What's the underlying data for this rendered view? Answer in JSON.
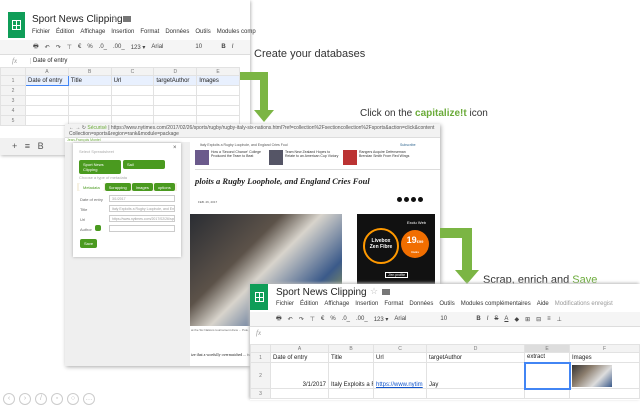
{
  "top_sheet": {
    "title": "Sport News Clipping",
    "menu": [
      "Fichier",
      "Édition",
      "Affichage",
      "Insertion",
      "Format",
      "Données",
      "Outils",
      "Modules comp"
    ],
    "toolbar": {
      "currency": "€",
      "percent": "%",
      "dec_less": ".0_",
      "dec_more": ".00_",
      "format": "123 ▾",
      "font": "Arial",
      "size": "10",
      "bold": "B",
      "italic": "I"
    },
    "formula_label": "fx",
    "formula": "Date of entry",
    "columns": [
      "A",
      "B",
      "C",
      "D",
      "E"
    ],
    "rows": [
      "1",
      "2",
      "3",
      "4",
      "5"
    ],
    "headers": [
      "Date of entry",
      "Title",
      "Url",
      "targetAuthor",
      "Images"
    ],
    "sheet_tab": "B"
  },
  "captions": {
    "step1": "Create your databases",
    "step2_prefix": "Click on the ",
    "step2_highlight": "capitalize!t",
    "step2_suffix": " icon",
    "step3_prefix": "Scrap, enrich and ",
    "step3_highlight": "Save"
  },
  "browser": {
    "secure": "Sécurisé",
    "url": "https://www.nytimes.com/2017/02/26/sports/rugby/rugby-italy-six-nations.html?ref=collection%2Fsectioncollection%2Fsports&action=click&contentCollection=sports&region=rank&module=package",
    "user": "Jean-François Montel"
  },
  "popup": {
    "select_label": "Select Spreadsheet",
    "sheet_select": "Sport News Clipping",
    "tab_select": "Sail",
    "choose_label": "Choose a type of metadata",
    "tabs": [
      "Metadata",
      "Scrapping",
      "Images",
      "options"
    ],
    "fields": [
      {
        "label": "Date of entry",
        "value": "3/1/2017"
      },
      {
        "label": "Title",
        "value": "Italy Exploits a Rugby Loophole, and England"
      },
      {
        "label": "Url",
        "value": "https://www.nytimes.com/2017/02/26/sports/rugby"
      },
      {
        "label": "Author",
        "value": ""
      }
    ],
    "save": "Save"
  },
  "article": {
    "breadcrumb": "Italy Exploits a Rugby Loophole, and England Cries Foul",
    "subscribe": "Subscribe",
    "promos": [
      "How a 'Second Chance' College Produced the Team to Beat",
      "Team New Zealand Hopes to Relate to an American Cup Victory",
      "Rangers Acquire Defenseman Brendan Smith From Red Wings"
    ],
    "headline": "ploits a Rugby Loophole, and England Cries Foul",
    "date": "FEB. 26, 2017",
    "caption": "at the Six Nations tournament drew ... Pole, right, for help, he rebuffed",
    "body": "ize that a woefully overmatched ... ts. When the Pats begin an of",
    "ad": {
      "brand": "Exclu Web",
      "line1": "Livebox",
      "line2": "Zen Fibre",
      "price": "19",
      "cents": "€99",
      "unit": "/mois",
      "cta": "J'en profite"
    }
  },
  "bottom_sheet": {
    "title": "Sport News Clipping",
    "menu": [
      "Fichier",
      "Édition",
      "Affichage",
      "Insertion",
      "Format",
      "Données",
      "Outils",
      "Modules complémentaires",
      "Aide"
    ],
    "saved": "Modifications enregist",
    "toolbar": {
      "currency": "€",
      "percent": "%",
      "dec_less": ".0_",
      "dec_more": ".00_",
      "format": "123 ▾",
      "font": "Arial",
      "size": "10",
      "bold": "B",
      "italic": "I",
      "strike": "S",
      "color": "A"
    },
    "formula_label": "fx",
    "columns": [
      "A",
      "B",
      "C",
      "D",
      "E",
      "F"
    ],
    "headers": [
      "Date of entry",
      "Title",
      "Url",
      "targetAuthor",
      "extract",
      "Images"
    ],
    "row2": [
      "3/1/2017",
      "Italy Exploits a F",
      "https://www.nytim",
      "Jay",
      "",
      ""
    ],
    "rows": [
      "1",
      "2",
      "3"
    ]
  },
  "colors": {
    "sheets_green": "#0f9d58",
    "arrow_green": "#7bb544",
    "save_green": "#6bab3a",
    "nyt_ad_orange": "#f16e00"
  }
}
